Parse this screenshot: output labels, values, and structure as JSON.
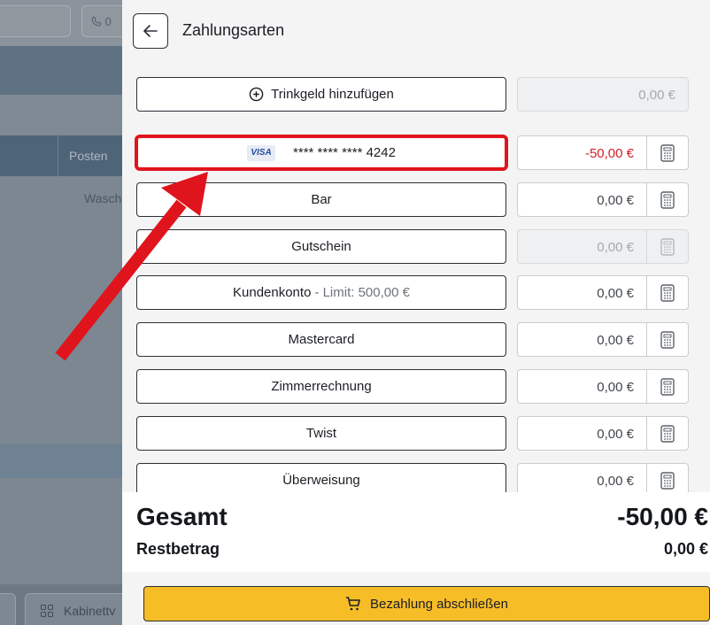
{
  "background": {
    "phone_prefix": "0",
    "column_header": "Posten",
    "row_text": "Wasch",
    "bottom_button": "Kabinettv"
  },
  "panel": {
    "title": "Zahlungsarten",
    "tip": {
      "label": "Trinkgeld hinzufügen",
      "amount": "0,00 €"
    },
    "payments": [
      {
        "label": "**** **** **** 4242",
        "badge": "VISA",
        "amount": "-50,00 €"
      },
      {
        "label": "Bar",
        "amount": "0,00 €"
      },
      {
        "label": "Gutschein",
        "amount": "0,00 €"
      },
      {
        "label": "Kundenkonto",
        "limit": "- Limit: 500,00 €",
        "amount": "0,00 €"
      },
      {
        "label": "Mastercard",
        "amount": "0,00 €"
      },
      {
        "label": "Zimmerrechnung",
        "amount": "0,00 €"
      },
      {
        "label": "Twist",
        "amount": "0,00 €"
      },
      {
        "label": "Überweisung",
        "amount": "0,00 €"
      }
    ],
    "summary": {
      "total_label": "Gesamt",
      "total_value": "-50,00 €",
      "remaining_label": "Restbetrag",
      "remaining_value": "0,00 €"
    },
    "pay_button": "Bezahlung abschließen"
  },
  "colors": {
    "highlight": "#e0141c",
    "negative_amount": "#d01f25",
    "pay_button": "#f6bd27"
  }
}
